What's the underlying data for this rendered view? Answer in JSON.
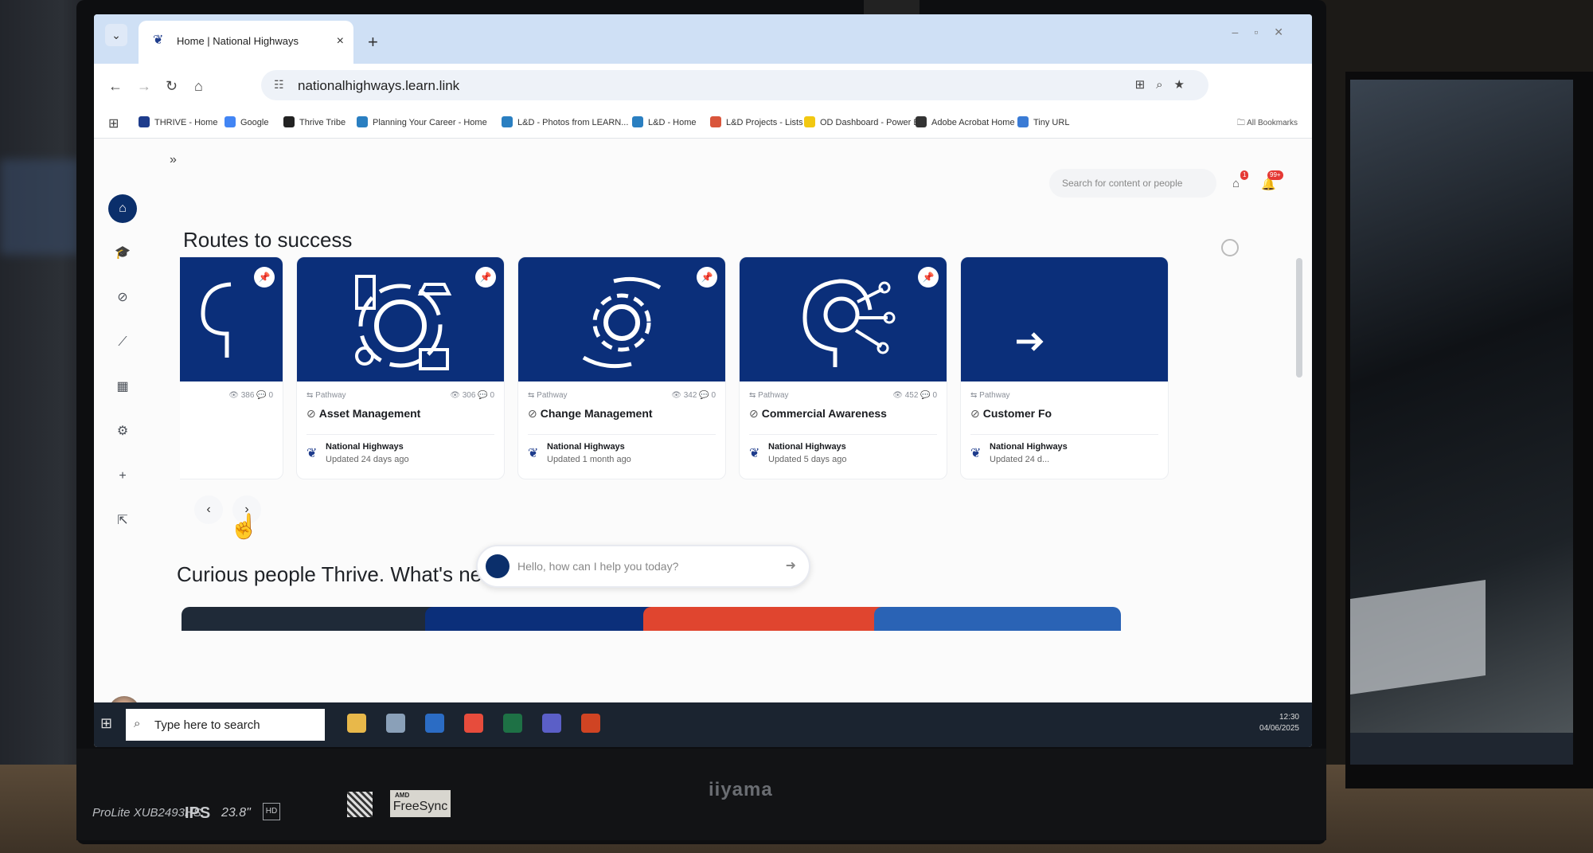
{
  "browser": {
    "tab_title": "Home | National Highways",
    "tab_close": "×",
    "new_tab": "+",
    "tab_menu": "⌄",
    "url": "nationalhighways.learn.link",
    "bookmarks": [
      {
        "label": "THRIVE - Home",
        "color": "#1e3c8c"
      },
      {
        "label": "Google",
        "color": "#4285f4"
      },
      {
        "label": "Thrive Tribe",
        "color": "#222222"
      },
      {
        "label": "Planning Your Career - Home",
        "color": "#2a7fc1"
      },
      {
        "label": "L&D - Photos from LEARN...",
        "color": "#2a7fc1"
      },
      {
        "label": "L&D - Home",
        "color": "#2a7fc1"
      },
      {
        "label": "L&D Projects - Lists",
        "color": "#d9553b"
      },
      {
        "label": "OD Dashboard - Power BI",
        "color": "#f2c811"
      },
      {
        "label": "Adobe Acrobat Home",
        "color": "#333333"
      },
      {
        "label": "Tiny URL",
        "color": "#3a7bd5"
      }
    ],
    "all_bookmarks": "All Bookmarks"
  },
  "page": {
    "expand": "»",
    "search_placeholder": "Search for content or people",
    "badge_1": "1",
    "badge_2": "99+",
    "section_title": "Routes to success",
    "section2_title": "Curious people Thrive. What's new?",
    "chat_placeholder": "Hello, how can I help you today?",
    "prev": "‹",
    "next": "›",
    "cards": [
      {
        "type": "",
        "views": "386",
        "comments": "0",
        "title": "",
        "org": "",
        "updated": ""
      },
      {
        "type": "Pathway",
        "views": "306",
        "comments": "0",
        "title": "Asset Management",
        "org": "National Highways",
        "updated": "Updated 24 days ago"
      },
      {
        "type": "Pathway",
        "views": "342",
        "comments": "0",
        "title": "Change Management",
        "org": "National Highways",
        "updated": "Updated 1 month ago"
      },
      {
        "type": "Pathway",
        "views": "452",
        "comments": "0",
        "title": "Commercial Awareness",
        "org": "National Highways",
        "updated": "Updated 5 days ago"
      },
      {
        "type": "Pathway",
        "views": "",
        "comments": "",
        "title": "Customer Fo",
        "org": "National Highways",
        "updated": "Updated 24 d..."
      }
    ]
  },
  "taskbar": {
    "search": "Type here to search",
    "time": "12:30",
    "date": "04/06/2025"
  },
  "monitor": {
    "brand": "iiyama",
    "model": "ProLite XUB2493HS",
    "panel": "IPS",
    "size": "23.8\"",
    "freesync": "FreeSync",
    "amd": "AMD"
  }
}
